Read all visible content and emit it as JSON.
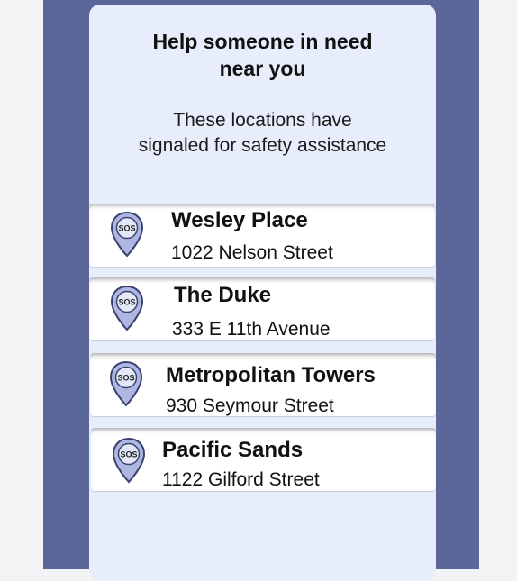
{
  "header": {
    "title_line1": "Help someone in need",
    "title_line2": "near you",
    "subtitle_line1": "These locations have",
    "subtitle_line2": "signaled for safety assistance"
  },
  "pin_icon": {
    "name": "sos-location-pin-icon",
    "label": "SOS",
    "fill": "#aeb7e2",
    "stroke": "#3a4270",
    "center": "#e3e8f8"
  },
  "locations": [
    {
      "name": "Wesley Place",
      "address": "1022 Nelson Street"
    },
    {
      "name": "The Duke",
      "address": "333 E 11th Avenue"
    },
    {
      "name": "Metropolitan Towers",
      "address": "930 Seymour Street"
    },
    {
      "name": "Pacific Sands",
      "address": "1122 Gilford Street"
    }
  ],
  "colors": {
    "frame": "#5c6799",
    "panel": "#e8edfc",
    "card": "#ffffff",
    "background": "#f3f3f5"
  }
}
